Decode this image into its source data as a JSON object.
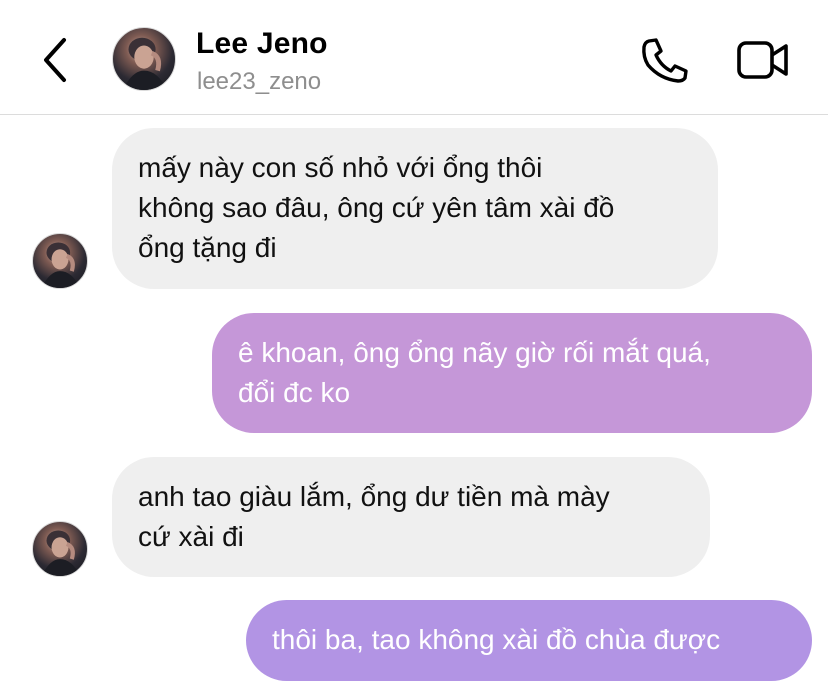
{
  "header": {
    "contact_name": "Lee Jeno",
    "username": "lee23_zeno",
    "icons": [
      "chevron-left-icon",
      "phone-icon",
      "video-camera-icon"
    ]
  },
  "messages": [
    {
      "direction": "incoming",
      "text": "mấy này con số nhỏ với ổng thôi\nkhông sao đâu, ông cứ yên tâm xài đồ\nổng tặng đi"
    },
    {
      "direction": "outgoing",
      "text": "ê khoan, ông ổng nãy giờ rối mắt quá,\nđổi đc ko"
    },
    {
      "direction": "incoming",
      "text": "anh tao giàu lắm, ổng dư tiền mà mày\ncứ xài đi"
    },
    {
      "direction": "outgoing",
      "text": "thôi ba, tao không xài đồ chùa được"
    }
  ],
  "colors": {
    "incoming_bubble": "#efefef",
    "outgoing_bubble_top": "#c597d8",
    "outgoing_bubble_bottom": "#b294e4",
    "username_text": "#8e8e8e"
  }
}
